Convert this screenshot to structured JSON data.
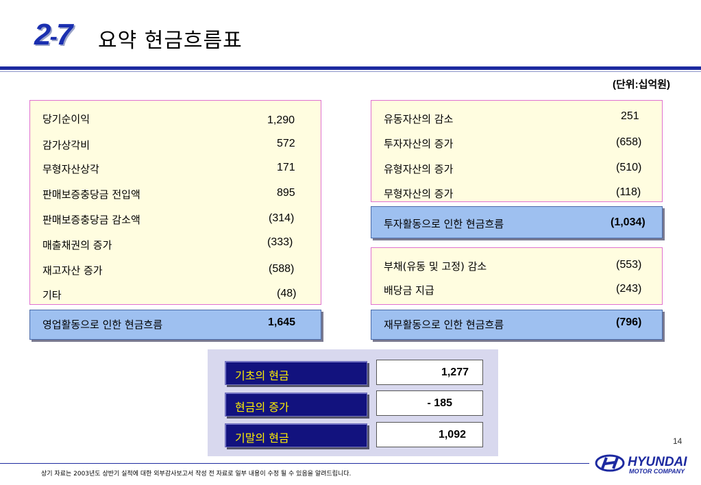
{
  "header": {
    "number_main": "2",
    "number_dash": "-",
    "number_sub": "7",
    "title": "요약 현금흐름표",
    "unit": "(단위:십억원)"
  },
  "operating": {
    "items": [
      {
        "label": "당기순이익",
        "value": "1,290"
      },
      {
        "label": "감가상각비",
        "value": "572"
      },
      {
        "label": "무형자산상각",
        "value": "171"
      },
      {
        "label": "판매보증충당금 전입액",
        "value": "895"
      },
      {
        "label": "판매보증충당금 감소액",
        "value": "(314)"
      },
      {
        "label": "매출채권의 증가",
        "value": "(333)"
      },
      {
        "label": "재고자산 증가",
        "value": "(588)"
      },
      {
        "label": "기타",
        "value": "(48)"
      }
    ],
    "total_label": "영업활동으로 인한 현금흐름",
    "total_value": "1,645"
  },
  "investing": {
    "items": [
      {
        "label": "유동자산의 감소",
        "value": "251"
      },
      {
        "label": "투자자산의 증가",
        "value": "(658)"
      },
      {
        "label": "유형자산의 증가",
        "value": "(510)"
      },
      {
        "label": "무형자산의 증가",
        "value": "(118)"
      }
    ],
    "total_label": "투자활동으로 인한 현금흐름",
    "total_value": "(1,034)"
  },
  "financing": {
    "items": [
      {
        "label": "부채(유동 및 고정) 감소",
        "value": "(553)"
      },
      {
        "label": "배당금 지급",
        "value": "(243)"
      }
    ],
    "total_label": "재무활동으로 인한 현금흐름",
    "total_value": "(796)"
  },
  "cash": [
    {
      "label": "기초의 현금",
      "value": "1,277"
    },
    {
      "label": "현금의 증가",
      "value": "- 185"
    },
    {
      "label": "기말의 현금",
      "value": "1,092"
    }
  ],
  "footer": {
    "page_number": "14",
    "note": "상기 자료는 2003년도 상반기 실적에 대한 외부감사보고서 작성 전 자료로 일부 내용이 수정 될 수 있음을 알려드립니다.",
    "logo_text": "HYUNDAI",
    "logo_sub": "MOTOR COMPANY"
  },
  "colors": {
    "accent": "#1d2aa0",
    "box_fill": "#fffde0",
    "total_fill": "#9ec0f0",
    "cash_label_fill": "#12127e",
    "cash_label_text": "#ffef00"
  }
}
